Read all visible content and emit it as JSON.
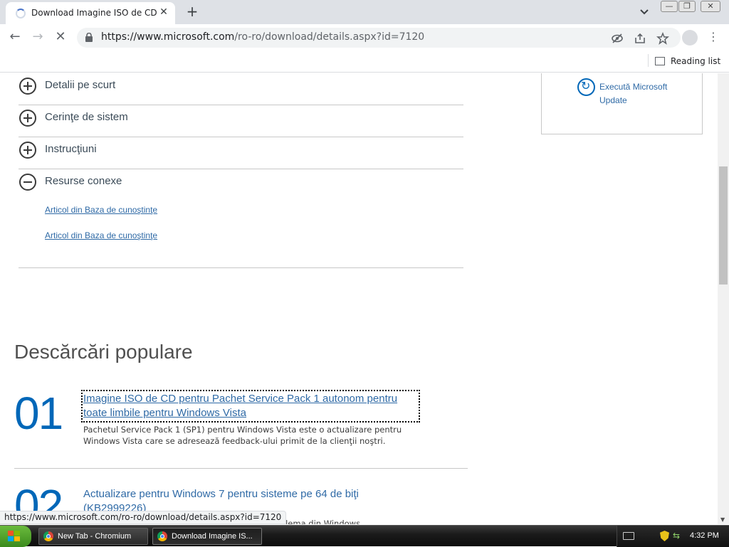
{
  "browser": {
    "tab_title": "Download Imagine ISO de CD p",
    "url_host": "https://www.microsoft.com",
    "url_path": "/ro-ro/download/details.aspx?id=7120",
    "reading_list_label": "Reading list"
  },
  "page": {
    "accordion": [
      {
        "label": "Detalii pe scurt",
        "state": "collapsed"
      },
      {
        "label": "Cerinţe de sistem",
        "state": "collapsed"
      },
      {
        "label": "Instrucţiuni",
        "state": "collapsed"
      },
      {
        "label": "Resurse conexe",
        "state": "expanded"
      }
    ],
    "related_links": [
      "Articol din Baza de cunoştinţe",
      "Articol din Baza de cunoştinţe"
    ],
    "sidebar": {
      "update_label": "Execută Microsoft Update"
    },
    "popular": {
      "heading": "Descărcări populare",
      "items": [
        {
          "number": "01",
          "title": "Imagine ISO de CD pentru Pachet Service Pack 1 autonom pentru toate limbile pentru Windows Vista",
          "description": "Pachetul Service Pack 1 (SP1) pentru Windows Vista este o actualizare pentru Windows Vista care se adresează feedback-ului primit de la clienţii noştri."
        },
        {
          "number": "02",
          "title": "Actualizare pentru Windows 7 pentru sisteme pe 64 de biţi (KB2999226)",
          "description": "problema din Windows"
        }
      ]
    }
  },
  "status_url": "https://www.microsoft.com/ro-ro/download/details.aspx?id=7120",
  "taskbar": {
    "start_label": "start",
    "tasks": [
      "New Tab - Chromium",
      "Download Imagine IS..."
    ],
    "clock": "4:32 PM"
  },
  "colors": {
    "link": "#2f6aa6",
    "accent": "#0067b8"
  }
}
